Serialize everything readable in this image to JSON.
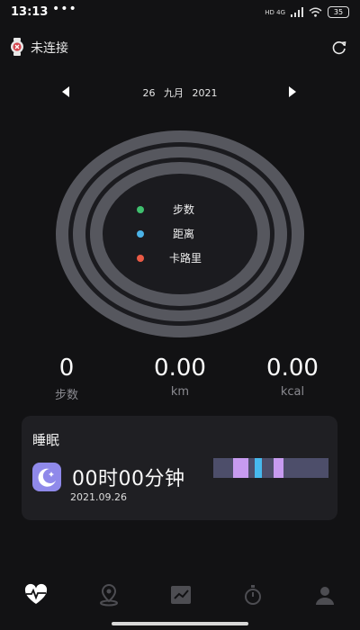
{
  "status_bar": {
    "time": "13:13",
    "dots": "•••",
    "network": "HD 4G",
    "battery": "35"
  },
  "header": {
    "connection_status": "未连接"
  },
  "date_nav": {
    "day": "26",
    "month": "九月",
    "year": "2021"
  },
  "rings_legend": [
    {
      "label": "步数",
      "color": "#3fbf6e"
    },
    {
      "label": "距离",
      "color": "#4bb3e8"
    },
    {
      "label": "卡路里",
      "color": "#ea5a45"
    }
  ],
  "stats": [
    {
      "value": "0",
      "label": "步数"
    },
    {
      "value": "0.00",
      "label": "km"
    },
    {
      "value": "0.00",
      "label": "kcal"
    }
  ],
  "sleep_card": {
    "title": "睡眠",
    "duration": "00时00分钟",
    "date": "2021.09.26",
    "bar_segments": [
      {
        "color": "#c79bf0"
      },
      {
        "color": "#47b9ee"
      },
      {
        "color": "#c79bf0"
      }
    ]
  },
  "bottom_nav": [
    {
      "icon": "heart-pulse-icon",
      "active": true
    },
    {
      "icon": "location-pin-icon",
      "active": false
    },
    {
      "icon": "trend-chart-icon",
      "active": false
    },
    {
      "icon": "stopwatch-icon",
      "active": false
    },
    {
      "icon": "profile-icon",
      "active": false
    }
  ]
}
